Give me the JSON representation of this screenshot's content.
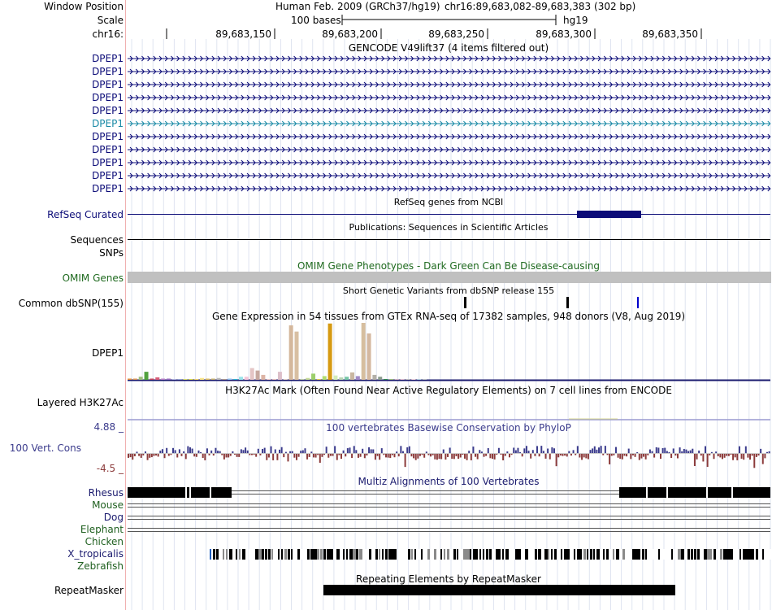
{
  "ruler": {
    "window_label": "Window Position",
    "scale_label": "Scale",
    "chrom_label": "chr16:",
    "assembly": "Human Feb. 2009 (GRCh37/hg19)",
    "position": "chr16:89,683,082-89,683,383 (302 bp)",
    "scale_text": "100 bases",
    "db": "hg19",
    "ticks": [
      "89,683,150",
      "89,683,200",
      "89,683,250",
      "89,683,300",
      "89,683,350"
    ]
  },
  "gencode": {
    "title": "GENCODE V49lift37 (4 items filtered out)",
    "items": [
      "DPEP1",
      "DPEP1",
      "DPEP1",
      "DPEP1",
      "DPEP1",
      "DPEP1",
      "DPEP1",
      "DPEP1",
      "DPEP1",
      "DPEP1",
      "DPEP1"
    ]
  },
  "refseq": {
    "title": "RefSeq genes from NCBI",
    "label": "RefSeq Curated"
  },
  "publications": {
    "title": "Publications: Sequences in Scientific Articles",
    "label": "Sequences"
  },
  "snps": {
    "label": "SNPs"
  },
  "omim": {
    "title": "OMIM Gene Phenotypes - Dark Green Can Be Disease-causing",
    "label": "OMIM Genes"
  },
  "dbsnp": {
    "title": "Short Genetic Variants from dbSNP release 155",
    "label": "Common dbSNP(155)"
  },
  "gtex": {
    "title": "Gene Expression in 54 tissues from GTEx RNA-seq of 17382 samples, 948 donors (V8, Aug 2019)",
    "label": "DPEP1",
    "values": [
      2,
      2,
      5,
      13,
      2,
      4,
      2,
      2,
      1,
      1,
      1,
      1,
      1,
      3,
      2,
      2,
      3,
      1,
      2,
      1,
      5,
      5,
      19,
      15,
      8,
      1,
      1,
      13,
      1,
      88,
      78,
      1,
      3,
      10,
      1,
      6,
      91,
      7,
      4,
      5,
      12,
      6,
      92,
      75,
      8,
      5,
      1,
      1,
      1,
      1,
      1,
      1,
      1,
      1
    ],
    "colors": [
      "#e69340",
      "#e09a5a",
      "#9fbf7e",
      "#52a13f",
      "#c8495d",
      "#d85e79",
      "#bb80c8",
      "#9b6fc3",
      "#b4b6e1",
      "#98a7d8",
      "#e0e36a",
      "#dfe04c",
      "#fcdd6a",
      "#fae58b",
      "#e3c468",
      "#c6b26e",
      "#bbbbbb",
      "#b29e8e",
      "#92c5f2",
      "#30b8d8",
      "#9ce4ea",
      "#f4c6d8",
      "#e4c5c5",
      "#c7a89f",
      "#ddb4a5",
      "#f2d0cc",
      "#ecc6c2",
      "#dcbfc9",
      "#e7d7ca",
      "#d4b79c",
      "#d8bfa2",
      "#c4d3ad",
      "#c7dc99",
      "#9ccf6c",
      "#e3d455",
      "#b2de6f",
      "#d69a12",
      "#d3ecb8",
      "#b9d6b7",
      "#76c6a6",
      "#c9b7a1",
      "#a08ac6",
      "#d6be9e",
      "#d4b8a0",
      "#b3b0a8",
      "#8c9d8f",
      "#2f8c4f",
      "#a0c07f",
      "#d3b7c6",
      "#e4c5d3",
      "#c4c4c4",
      "#f3d7df",
      "#b6d4e2",
      "#bfc4c8"
    ]
  },
  "h3k27ac": {
    "title": "H3K27Ac Mark (Often Found Near Active Regulatory Elements) on 7 cell lines from ENCODE",
    "label": "Layered H3K27Ac"
  },
  "phylop": {
    "title": "100 vertebrates Basewise Conservation by PhyloP",
    "label": "100 Vert. Cons",
    "max": "4.88 _",
    "min": "-4.5 _"
  },
  "multiz": {
    "title": "Multiz Alignments of 100 Vertebrates",
    "species": [
      "Rhesus",
      "Mouse",
      "Dog",
      "Elephant",
      "Chicken",
      "X_tropicalis",
      "Zebrafish"
    ],
    "colors": [
      "#1a1a6e",
      "#206020",
      "#1a1a6e",
      "#206020",
      "#206020",
      "#1a1a6e",
      "#206020"
    ]
  },
  "repeatmasker": {
    "title": "Repeating Elements by RepeatMasker",
    "label": "RepeatMasker"
  },
  "colors": {
    "navy": "#0c0c78",
    "highlight": "#1a8aa6",
    "omim_gray": "#c0c0c0",
    "green": "#1f6a1f",
    "cons_pos": "#3b3b8c",
    "cons_neg": "#8c3b3b"
  }
}
